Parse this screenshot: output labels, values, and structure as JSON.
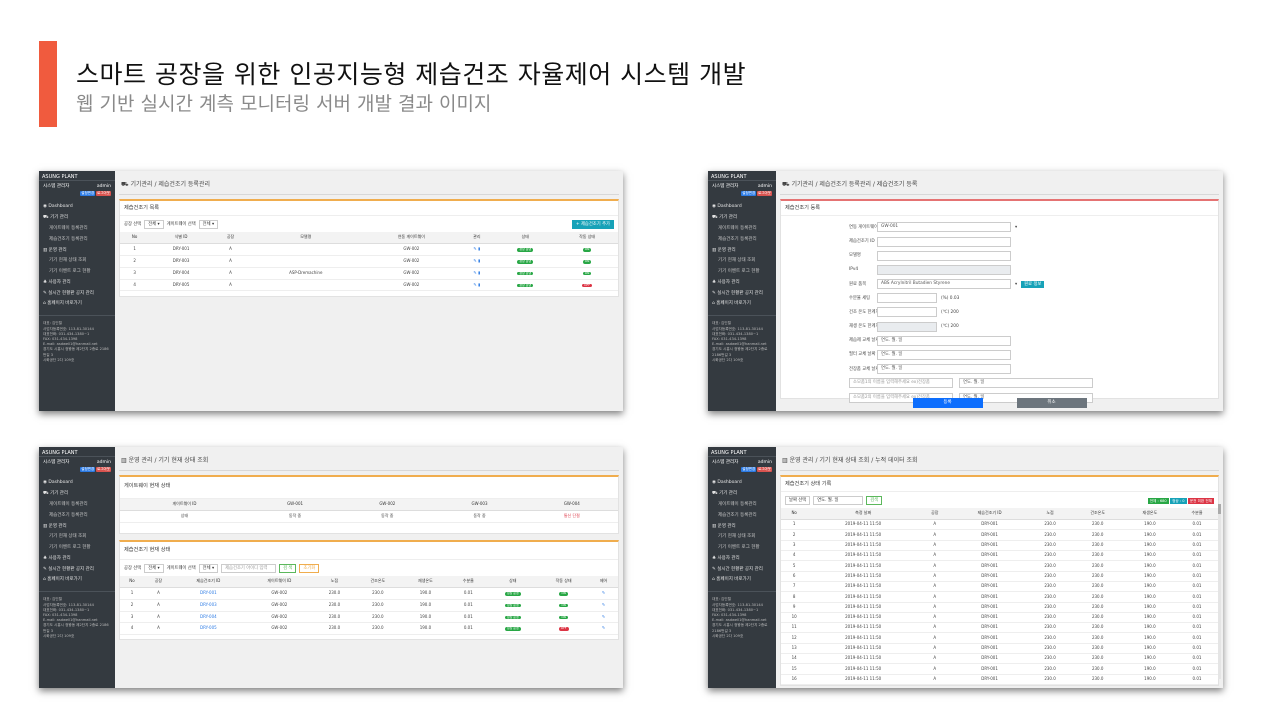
{
  "slide": {
    "title": "스마트 공장을 위한 인공지능형 제습건조 자율제어 시스템 개발",
    "subtitle": "웹 기반 실시간 계측 모니터링 서버 개발 결과 이미지",
    "accent_color": "#f05b3e"
  },
  "sidebar": {
    "brand": "ASUNG PLANT",
    "user_role": "시스템 관리자",
    "user_name": "admin",
    "badge_a": "설정변경",
    "badge_b": "로그아웃",
    "items": [
      "Dashboard",
      "기기 관리",
      "게이트웨이 등록관리",
      "제습건조기 등록관리",
      "운영 관리",
      "기기 현재 상태 조회",
      "기기 이벤트 로그 현황",
      "사용자 관리",
      "실시간 현황판 공지 관리",
      "홈페이지 바로가기"
    ],
    "info": [
      "대표: 김인렬",
      "사업자등록번호: 113-81-30144",
      "대표전화: 031-434-1380~1",
      "FAX: 031-434-1398",
      "E-mail: asdwell1@hanmail.net",
      "경기도 시흥시 정왕동 제2단지 2종로 2186번길 3",
      "시화공단 2다 109호"
    ]
  },
  "screen1": {
    "breadcrumb": "기기관리 / 제습건조기 등록관리",
    "card_title": "제습건조기 목록",
    "filter_plant_label": "공장 선택",
    "filter_plant_value": "전체",
    "filter_gw_label": "게이트웨이 선택",
    "filter_gw_value": "전체",
    "add_button": "+ 제습건조기 추가",
    "columns": [
      "No",
      "식별 ID",
      "공장",
      "모델명",
      "연동 게이트웨이",
      "관리",
      "상태",
      "작동 상태"
    ],
    "rows": [
      {
        "no": "1",
        "id": "DRY-001",
        "plant": "A",
        "model": "",
        "gw": "GW-002",
        "status": "정상 운영",
        "op": "ON",
        "op_red": false
      },
      {
        "no": "2",
        "id": "DRY-003",
        "plant": "A",
        "model": "",
        "gw": "GW-002",
        "status": "정상 운영",
        "op": "ON",
        "op_red": false
      },
      {
        "no": "3",
        "id": "DRY-004",
        "plant": "A",
        "model": "ASP-Dremachine",
        "gw": "GW-002",
        "status": "정상 운영",
        "op": "ON",
        "op_red": false
      },
      {
        "no": "4",
        "id": "DRY-005",
        "plant": "A",
        "model": "",
        "gw": "GW-002",
        "status": "정상 운영",
        "op": "OFF",
        "op_red": true
      }
    ]
  },
  "screen2": {
    "breadcrumb": "기기관리 / 제습건조기 등록관리 / 제습건조기 등록",
    "card_title": "제습건조기 등록",
    "fields": [
      {
        "label": "연동 게이트웨이",
        "value": "GW-001",
        "kind": "select"
      },
      {
        "label": "제습건조기 ID",
        "value": "",
        "kind": "input"
      },
      {
        "label": "모델명",
        "value": "",
        "kind": "input"
      },
      {
        "label": "IPv4",
        "value": "",
        "kind": "gray"
      },
      {
        "label": "원료 품목",
        "value": "ABS Acrylnitril Butadien Styrene",
        "kind": "material"
      },
      {
        "label": "수분율 세팅",
        "value": "",
        "kind": "unit",
        "unit": "(%) 0.03"
      },
      {
        "label": "건조 온도 한계치 세팅",
        "value": "",
        "kind": "unit",
        "unit": "(℃) 200"
      },
      {
        "label": "재생 온도 한계치 세팅",
        "value": "",
        "kind": "unit-gray",
        "unit": "(℃) 200"
      },
      {
        "label": "제습제 교체 날짜 설정",
        "value": "연도. 월. 일",
        "kind": "input"
      },
      {
        "label": "필터 교체 날짜 설정",
        "value": "연도. 월. 일",
        "kind": "input"
      },
      {
        "label": "전장품 교체 날짜 설정",
        "value": "연도. 월. 일",
        "kind": "input"
      },
      {
        "label": "",
        "value": "연도. 월. 일",
        "kind": "custom",
        "custom": "소모품1의 이름을 입력해주세요 ex)전장품"
      },
      {
        "label": "",
        "value": "연도. 월. 일",
        "kind": "custom",
        "custom": "소모품2의 이름을 입력해주세요 ex)전장품"
      }
    ],
    "material_button": "원료 정보",
    "save_button": "등록",
    "cancel_button": "취소"
  },
  "screen3": {
    "breadcrumb": "운영 관리 / 기기 현재 상태 조회",
    "gw_card_title": "게이트웨이 현재 상태",
    "gw_columns": [
      "게이트웨이 ID",
      "GW-001",
      "GW-002",
      "GW-003",
      "GW-004"
    ],
    "gw_row": [
      "상태",
      "동작 중",
      "동작 중",
      "동작 중",
      "통신 단절"
    ],
    "dry_card_title": "제습건조기 현재 상태",
    "filter_plant_label": "공장 선택",
    "filter_plant_value": "전체",
    "filter_gw_label": "게이트웨이 선택",
    "filter_gw_value": "전체",
    "search_placeholder": "제습건조기 아이디 입력",
    "search_button": "검 색",
    "reset_button": "초기화",
    "columns": [
      "No",
      "공장",
      "제습건조기 ID",
      "게이트웨이 ID",
      "노점",
      "건조온도",
      "재생온도",
      "수분율",
      "상태",
      "작동 상태",
      "제어"
    ],
    "rows": [
      {
        "no": "1",
        "plant": "A",
        "id": "DRY-001",
        "gw": "GW-002",
        "dew": "230.0",
        "dry": "230.0",
        "regen": "190.0",
        "moist": "0.01",
        "status": "정상 운영",
        "op": "ON",
        "op_red": false
      },
      {
        "no": "2",
        "plant": "A",
        "id": "DRY-003",
        "gw": "GW-002",
        "dew": "230.0",
        "dry": "230.0",
        "regen": "190.0",
        "moist": "0.01",
        "status": "정상 운영",
        "op": "ON",
        "op_red": false
      },
      {
        "no": "3",
        "plant": "A",
        "id": "DRY-004",
        "gw": "GW-002",
        "dew": "230.0",
        "dry": "230.0",
        "regen": "190.0",
        "moist": "0.01",
        "status": "정상 운영",
        "op": "ON",
        "op_red": false
      },
      {
        "no": "4",
        "plant": "A",
        "id": "DRY-005",
        "gw": "GW-002",
        "dew": "230.0",
        "dry": "230.0",
        "regen": "190.0",
        "moist": "0.01",
        "status": "정상 운영",
        "op": "OFF",
        "op_red": true
      }
    ]
  },
  "screen4": {
    "breadcrumb": "운영 관리 / 기기 현재 상태 조회 / 누적 데이터 조회",
    "card_title": "제습건조기 상태 기록",
    "date_label": "날짜 선택",
    "date_value": "연도. 월. 일",
    "search_button": "검색",
    "tag_all": "전체 : 680",
    "tag_ok": "정상 : 0",
    "tag_err": "운전 미완 전체",
    "columns": [
      "No",
      "측정 날짜",
      "공장",
      "제습건조기 ID",
      "노점",
      "건조온도",
      "재생온도",
      "수분율"
    ],
    "rows": [
      [
        "1",
        "2019-04-11 11:50",
        "A",
        "DRY-001",
        "230.0",
        "230.0",
        "190.0",
        "0.01"
      ],
      [
        "2",
        "2019-04-11 11:50",
        "A",
        "DRY-001",
        "230.0",
        "230.0",
        "190.0",
        "0.01"
      ],
      [
        "3",
        "2019-04-11 11:50",
        "A",
        "DRY-001",
        "230.0",
        "230.0",
        "190.0",
        "0.01"
      ],
      [
        "4",
        "2019-04-11 11:50",
        "A",
        "DRY-001",
        "230.0",
        "230.0",
        "190.0",
        "0.01"
      ],
      [
        "5",
        "2019-04-11 11:50",
        "A",
        "DRY-001",
        "230.0",
        "230.0",
        "190.0",
        "0.01"
      ],
      [
        "6",
        "2019-04-11 11:50",
        "A",
        "DRY-001",
        "230.0",
        "230.0",
        "190.0",
        "0.01"
      ],
      [
        "7",
        "2019-04-11 11:50",
        "A",
        "DRY-001",
        "230.0",
        "230.0",
        "190.0",
        "0.01"
      ],
      [
        "8",
        "2019-04-11 11:50",
        "A",
        "DRY-001",
        "230.0",
        "230.0",
        "190.0",
        "0.01"
      ],
      [
        "9",
        "2019-04-11 11:50",
        "A",
        "DRY-001",
        "230.0",
        "230.0",
        "190.0",
        "0.01"
      ],
      [
        "10",
        "2019-04-11 11:50",
        "A",
        "DRY-001",
        "230.0",
        "230.0",
        "190.0",
        "0.01"
      ],
      [
        "11",
        "2019-04-11 11:50",
        "A",
        "DRY-001",
        "230.0",
        "230.0",
        "190.0",
        "0.01"
      ],
      [
        "12",
        "2019-04-11 11:50",
        "A",
        "DRY-001",
        "230.0",
        "230.0",
        "190.0",
        "0.01"
      ],
      [
        "13",
        "2019-04-11 11:50",
        "A",
        "DRY-001",
        "230.0",
        "230.0",
        "190.0",
        "0.01"
      ],
      [
        "14",
        "2019-04-11 11:50",
        "A",
        "DRY-001",
        "230.0",
        "230.0",
        "190.0",
        "0.01"
      ],
      [
        "15",
        "2019-04-11 11:50",
        "A",
        "DRY-001",
        "230.0",
        "230.0",
        "190.0",
        "0.01"
      ],
      [
        "16",
        "2019-04-11 11:50",
        "A",
        "DRY-001",
        "230.0",
        "230.0",
        "190.0",
        "0.01"
      ]
    ]
  }
}
